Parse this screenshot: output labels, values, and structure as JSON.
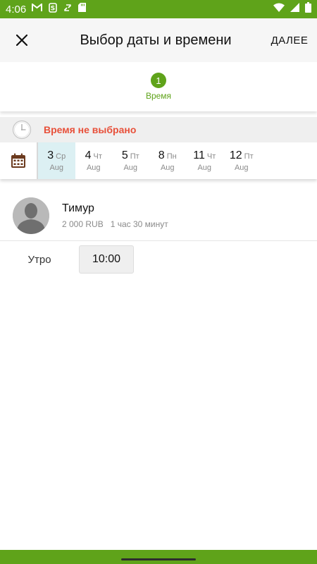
{
  "status_bar": {
    "time": "4:06",
    "icons": [
      "gmail-icon",
      "s-app-icon",
      "sync-icon",
      "sd-card-icon",
      "wifi-icon",
      "cell-signal-icon",
      "battery-icon"
    ]
  },
  "app_bar": {
    "close_icon": "close-icon",
    "title": "Выбор даты и времени",
    "next_label": "ДАЛЕЕ"
  },
  "stepper": {
    "step_number": "1",
    "step_label": "Время"
  },
  "warning": {
    "icon": "clock-icon",
    "text": "Время не выбрано"
  },
  "dates": {
    "calendar_icon": "calendar-icon",
    "items": [
      {
        "day": "3",
        "dow": "Ср",
        "month": "Aug",
        "selected": true
      },
      {
        "day": "4",
        "dow": "Чт",
        "month": "Aug",
        "selected": false
      },
      {
        "day": "5",
        "dow": "Пт",
        "month": "Aug",
        "selected": false
      },
      {
        "day": "8",
        "dow": "Пн",
        "month": "Aug",
        "selected": false
      },
      {
        "day": "11",
        "dow": "Чт",
        "month": "Aug",
        "selected": false
      },
      {
        "day": "12",
        "dow": "Пт",
        "month": "Aug",
        "selected": false
      }
    ]
  },
  "master": {
    "name": "Тимур",
    "price": "2 000 RUB",
    "duration": "1 час 30 минут"
  },
  "slots": {
    "period_label": "Утро",
    "times": [
      "10:00"
    ]
  },
  "colors": {
    "brand": "#5fa31a",
    "warning": "#e8503a",
    "selected_date_bg": "#dcf0f3",
    "calendar_icon": "#6b3a1e"
  }
}
